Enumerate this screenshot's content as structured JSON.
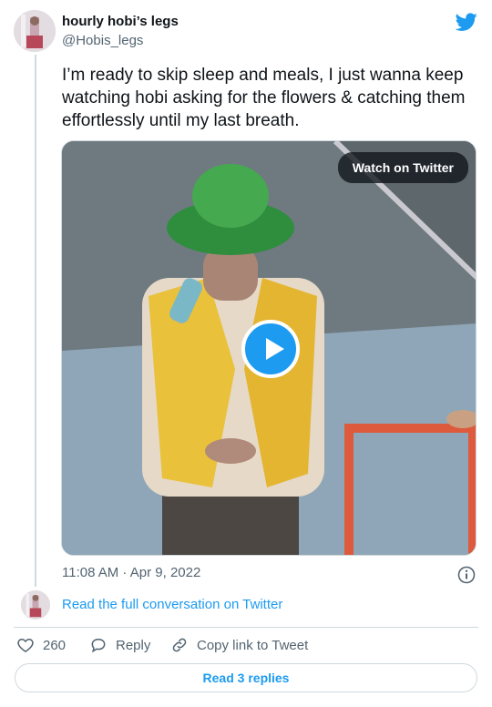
{
  "tweet": {
    "display_name": "hourly hobi’s legs",
    "handle": "@Hobis_legs",
    "text": "I’m ready to skip sleep and meals, I just wanna keep watching hobi asking for the flowers & catching them effortlessly until my last breath.",
    "timestamp": "11:08 AM · Apr 9, 2022",
    "avatar_icon": "profile-photo-icon",
    "brand_icon": "twitter-bird-icon",
    "accent_color": "#1d9bf0"
  },
  "media": {
    "watch_label": "Watch on Twitter",
    "play_icon": "play-icon"
  },
  "conversation": {
    "read_full_label": "Read the full conversation on Twitter"
  },
  "actions": {
    "like_count": "260",
    "reply_label": "Reply",
    "copy_label": "Copy link to Tweet",
    "read_replies_label": "Read 3 replies"
  }
}
